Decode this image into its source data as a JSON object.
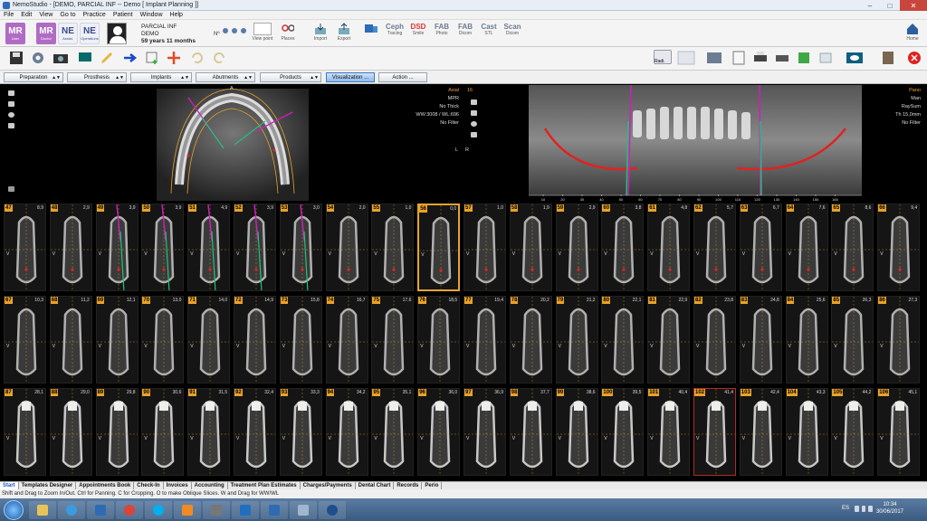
{
  "window": {
    "title": "NemoStudio - [DEMO, PARCIAL INF -- Demo [ Implant Planning ]]"
  },
  "menu": [
    "File",
    "Edit",
    "View",
    "Go to",
    "Practice",
    "Patient",
    "Window",
    "Help"
  ],
  "tiles": [
    {
      "text": "MR",
      "sub": "User"
    },
    {
      "text": "MR",
      "sub": "Doctor"
    },
    {
      "text": "NE",
      "sub": "Assist."
    },
    {
      "text": "NE",
      "sub": "Operations"
    }
  ],
  "patient": {
    "name": "PARCIAL INF",
    "last": "DEMO",
    "age": "59 years 11 months",
    "n_label": "Nº"
  },
  "toolbar_labels": {
    "viewpoint": "View point",
    "places": "Places",
    "import": "Import",
    "export": "Export",
    "ceph": "Ceph",
    "ceph_sub": "Tracing",
    "dsd": "DSD",
    "dsd_sub": "Smile",
    "fab1": "FAB",
    "fab1_sub": "Photo",
    "fab2": "FAB",
    "fab2_sub": "Dicom",
    "cast": "Cast",
    "cast_sub": "STL",
    "scan": "Scan",
    "scan_sub": "Dicom",
    "home": "Home",
    "radi": "Radi."
  },
  "planning_tabs": [
    {
      "label": "Preparation"
    },
    {
      "label": "Prosthesis"
    },
    {
      "label": "Implants"
    },
    {
      "label": "Abutments"
    },
    {
      "label": "Products"
    },
    {
      "label": "Visualization ..."
    },
    {
      "label": "Action ..."
    }
  ],
  "axial": {
    "title": "Axial",
    "mode": "MPR",
    "thick": "No Thick",
    "wwwl": "WW:3008 / WL:696",
    "filter": "No Filter",
    "orientation_top": "A",
    "orientation_right": "L"
  },
  "pano": {
    "title": "Pano",
    "mode": "Man",
    "render": "RaySum",
    "th": "Th 15,0mm",
    "filter": "No Filter",
    "index": "16",
    "left": "R",
    "ruler": [
      "10",
      "20",
      "30",
      "40",
      "50",
      "60",
      "70",
      "80",
      "90",
      "100",
      "110",
      "120",
      "130",
      "140",
      "150",
      "160"
    ]
  },
  "slices": [
    {
      "n": "47",
      "mm": "8,9"
    },
    {
      "n": "48",
      "mm": "2,9"
    },
    {
      "n": "49",
      "mm": "3,9"
    },
    {
      "n": "50",
      "mm": "3,9"
    },
    {
      "n": "51",
      "mm": "4,9"
    },
    {
      "n": "52",
      "mm": "3,9"
    },
    {
      "n": "53",
      "mm": "3,0"
    },
    {
      "n": "54",
      "mm": "2,0"
    },
    {
      "n": "55",
      "mm": "1,0"
    },
    {
      "n": "56",
      "mm": "0,0"
    },
    {
      "n": "57",
      "mm": "1,0"
    },
    {
      "n": "58",
      "mm": "1,9"
    },
    {
      "n": "59",
      "mm": "2,9"
    },
    {
      "n": "60",
      "mm": "3,8"
    },
    {
      "n": "61",
      "mm": "4,8"
    },
    {
      "n": "62",
      "mm": "5,7"
    },
    {
      "n": "63",
      "mm": "6,7"
    },
    {
      "n": "64",
      "mm": "7,6"
    },
    {
      "n": "65",
      "mm": "8,6"
    },
    {
      "n": "66",
      "mm": "9,4"
    },
    {
      "n": "67",
      "mm": "10,3"
    },
    {
      "n": "68",
      "mm": "11,2"
    },
    {
      "n": "69",
      "mm": "12,1"
    },
    {
      "n": "70",
      "mm": "13,0"
    },
    {
      "n": "71",
      "mm": "14,0"
    },
    {
      "n": "72",
      "mm": "14,9"
    },
    {
      "n": "73",
      "mm": "15,8"
    },
    {
      "n": "74",
      "mm": "16,7"
    },
    {
      "n": "75",
      "mm": "17,6"
    },
    {
      "n": "76",
      "mm": "18,5"
    },
    {
      "n": "77",
      "mm": "19,4"
    },
    {
      "n": "78",
      "mm": "20,2"
    },
    {
      "n": "79",
      "mm": "21,2"
    },
    {
      "n": "80",
      "mm": "22,1"
    },
    {
      "n": "81",
      "mm": "22,9"
    },
    {
      "n": "82",
      "mm": "23,8"
    },
    {
      "n": "83",
      "mm": "24,8"
    },
    {
      "n": "84",
      "mm": "25,6"
    },
    {
      "n": "85",
      "mm": "26,3"
    },
    {
      "n": "86",
      "mm": "27,3"
    },
    {
      "n": "87",
      "mm": "28,1"
    },
    {
      "n": "88",
      "mm": "29,0"
    },
    {
      "n": "89",
      "mm": "29,8"
    },
    {
      "n": "90",
      "mm": "30,6"
    },
    {
      "n": "91",
      "mm": "31,5"
    },
    {
      "n": "92",
      "mm": "32,4"
    },
    {
      "n": "93",
      "mm": "33,3"
    },
    {
      "n": "94",
      "mm": "34,2"
    },
    {
      "n": "95",
      "mm": "35,1"
    },
    {
      "n": "96",
      "mm": "36,0"
    },
    {
      "n": "97",
      "mm": "36,9"
    },
    {
      "n": "98",
      "mm": "37,7"
    },
    {
      "n": "99",
      "mm": "38,6"
    },
    {
      "n": "100",
      "mm": "39,5"
    },
    {
      "n": "101",
      "mm": "40,4"
    },
    {
      "n": "102",
      "mm": "41,4"
    },
    {
      "n": "103",
      "mm": "42,4"
    },
    {
      "n": "104",
      "mm": "43,3"
    },
    {
      "n": "105",
      "mm": "44,2"
    },
    {
      "n": "106",
      "mm": "45,1"
    }
  ],
  "bottom_tabs": [
    "Start",
    "Templates Designer",
    "Appointments Book",
    "Check-In",
    "Invoices",
    "Accounting",
    "Treatment Plan Estimates",
    "Charges/Payments",
    "Dental Chart",
    "Records",
    "Perio"
  ],
  "status": "Shift and Drag to Zoom In/Out. Ctrl for Panning. C for Cropping. O to make Oblique Slices. W and Drag for WW/WL",
  "system": {
    "lang": "ES",
    "time": "10:34",
    "date": "30/06/2017"
  },
  "colors": {
    "accent": "#e9a227",
    "selected_tab": "#8fb9ea",
    "tile": "#b06cc4",
    "implant_magenta": "#d01ec0",
    "implant_green": "#22c07a",
    "nerve_red": "#e02222"
  }
}
